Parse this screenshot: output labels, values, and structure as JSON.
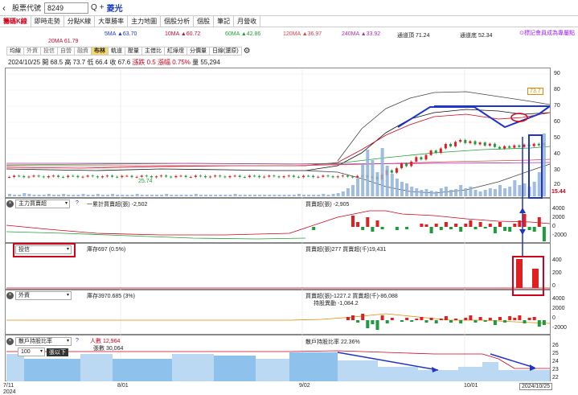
{
  "topbar": {
    "label": "股票代號",
    "code": "8249",
    "search_glyph": "Q",
    "plus_glyph": "+",
    "stock_name": "菱光"
  },
  "tabs": [
    "籌碼K線",
    "即時走勢",
    "分點K線",
    "大單勝率",
    "主力地圖",
    "個股分析",
    "個股",
    "筆記",
    "月營收"
  ],
  "ma_legend": {
    "ma5": "5MA ▲63.70",
    "ma10": "10MA ▲60.72",
    "ma60": "60MA ▲42.86",
    "ma120": "120MA ▲36.97",
    "ma240": "240MA ▲33.92",
    "upper": "通道頂 71.24",
    "lower": "通道底 52.34",
    "ma20": "20MA 61.79"
  },
  "hint": "⊙標記會員成為專屬點",
  "toolbar2": [
    "均線",
    "外資",
    "投信",
    "自營",
    "融資",
    "布林",
    "軌道",
    "壓量",
    "主借比",
    "紅綠燈",
    "分價量",
    "日線(還原)"
  ],
  "quote": {
    "date": "2024/10/25",
    "open": "開 68.5",
    "high": "高 73.7",
    "low": "低 66.4",
    "close": "收 67.6",
    "chg": "漲跌 0.5",
    "pct": "漲幅 0.75%",
    "vol": "量 55,294"
  },
  "price_axis": [
    "90",
    "80",
    "70",
    "60",
    "50",
    "40",
    "30",
    "20"
  ],
  "price_callouts": {
    "high": "73.7",
    "low": "25.74",
    "vol_level": "15.44"
  },
  "panel_main": {
    "select": "主力買賣超",
    "legend1": "一累計買賣超(張) -2,502",
    "legend2": "買賣超(張) -2,905",
    "axis": [
      "4000",
      "2000",
      "0",
      "-2000"
    ]
  },
  "panel_trust": {
    "select": "投信",
    "legend1": "庫存697 (0.5%)",
    "legend2": "買賣超(張)277 買賣超(千)19,431",
    "axis": [
      "400",
      "200",
      "0"
    ]
  },
  "panel_foreign": {
    "select": "外資",
    "legend1": "庫存3970.685 (3%)",
    "legend2": "買賣超(張)-1227.2 買賣超(千)-86,088",
    "legend3": "持股異動 -1,084.2",
    "axis": [
      "4000",
      "2000",
      "0",
      "-2000"
    ]
  },
  "panel_holders": {
    "select": "散戶持股比率",
    "legend1": "人數 12,964",
    "legend2": "張數 30,064",
    "legend3": "散戶持股比率 22.36%",
    "sub_select": "100",
    "sub_label": "張以下",
    "axis": [
      "26",
      "25",
      "24",
      "23",
      "22"
    ]
  },
  "dates": {
    "d1": "7/11",
    "year": "2024",
    "d2": "8/01",
    "d3": "9/02",
    "d4": "10/01",
    "d5": "2024/10/25"
  },
  "colors": {
    "up": "#e02020",
    "down": "#1e9c3c",
    "accent": "#1f35c9",
    "box": "#d0021b"
  },
  "chart_data": [
    {
      "type": "bar",
      "title": "",
      "series": [
        {
          "name": "5MA",
          "values": [
            63.7
          ]
        },
        {
          "name": "10MA",
          "values": [
            60.72
          ]
        },
        {
          "name": "20MA",
          "values": [
            61.79
          ]
        },
        {
          "name": "60MA",
          "values": [
            42.86
          ]
        },
        {
          "name": "120MA",
          "values": [
            36.97
          ]
        },
        {
          "name": "240MA",
          "values": [
            33.92
          ]
        }
      ],
      "ylim": [
        20,
        90
      ]
    }
  ]
}
